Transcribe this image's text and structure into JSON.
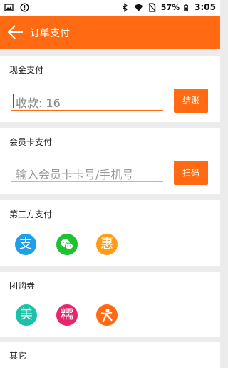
{
  "status_bar": {
    "battery_percent": "57%",
    "time": "3:05",
    "icons": [
      "image-icon",
      "info-icon",
      "bluetooth-icon",
      "wifi-icon",
      "no-sim-icon",
      "battery-icon"
    ]
  },
  "header": {
    "title": "订单支付",
    "back_icon": "back-arrow-icon",
    "background_color": "#ff6a13"
  },
  "cash": {
    "title": "现金支付",
    "input_value": "收款: 16",
    "button_label": "结账"
  },
  "member_card": {
    "title": "会员卡支付",
    "input_placeholder": "输入会员卡卡号/手机号",
    "button_label": "扫码"
  },
  "third_party": {
    "title": "第三方支付",
    "methods": [
      {
        "icon": "alipay-icon",
        "glyph": "支",
        "color": "#1e9fe8"
      },
      {
        "icon": "wechat-pay-icon",
        "glyph": "",
        "color": "#1ec12f"
      },
      {
        "icon": "hui-icon",
        "glyph": "惠",
        "color": "#ff9b16"
      }
    ]
  },
  "group_buy": {
    "title": "团购券",
    "methods": [
      {
        "icon": "meituan-icon",
        "glyph": "美",
        "color": "#19c2a8"
      },
      {
        "icon": "nuomi-icon",
        "glyph": "糯",
        "color": "#e8246d"
      },
      {
        "icon": "dianping-icon",
        "glyph": "",
        "color": "#ff6a13"
      }
    ]
  },
  "other": {
    "title": "其它"
  }
}
